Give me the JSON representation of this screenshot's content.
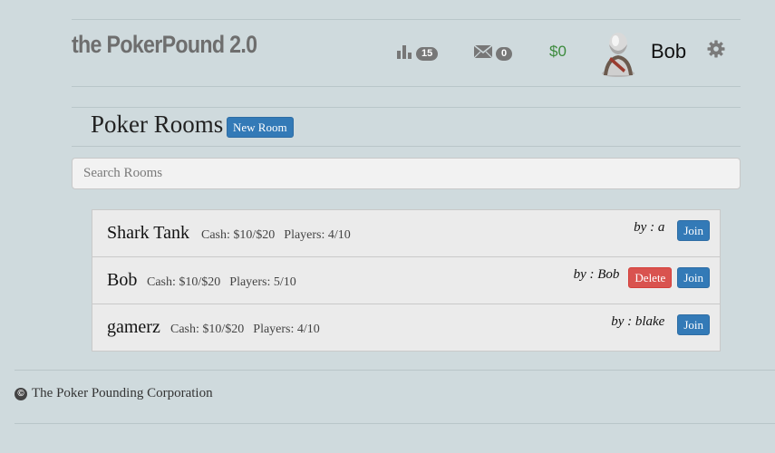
{
  "brand": "the PokerPound 2.0",
  "nav": {
    "stats_count": "15",
    "messages_count": "0",
    "balance": "$0",
    "username": "Bob"
  },
  "page": {
    "title": "Poker Rooms",
    "new_room_label": "New Room"
  },
  "search": {
    "placeholder": "Search Rooms"
  },
  "rooms": [
    {
      "name": "Shark Tank",
      "cash": "Cash: $10/$20",
      "players": "Players: 4/10",
      "by": "by : a",
      "delete_label": "",
      "join_label": "Join"
    },
    {
      "name": "Bob",
      "cash": "Cash: $10/$20",
      "players": "Players: 5/10",
      "by": "by : Bob",
      "delete_label": "Delete",
      "join_label": "Join"
    },
    {
      "name": "gamerz",
      "cash": "Cash: $10/$20",
      "players": "Players: 4/10",
      "by": "by : blake",
      "delete_label": "",
      "join_label": "Join"
    }
  ],
  "footer": {
    "copyright_symbol": "©",
    "text": "The Poker Pounding Corporation"
  },
  "colors": {
    "background": "#cfdadd",
    "primary": "#337ab7",
    "danger": "#d9534f",
    "money": "#3c8a3c"
  },
  "icons": [
    "bar-chart-icon",
    "envelope-icon",
    "avatar",
    "gear-icon",
    "copyright-icon"
  ]
}
